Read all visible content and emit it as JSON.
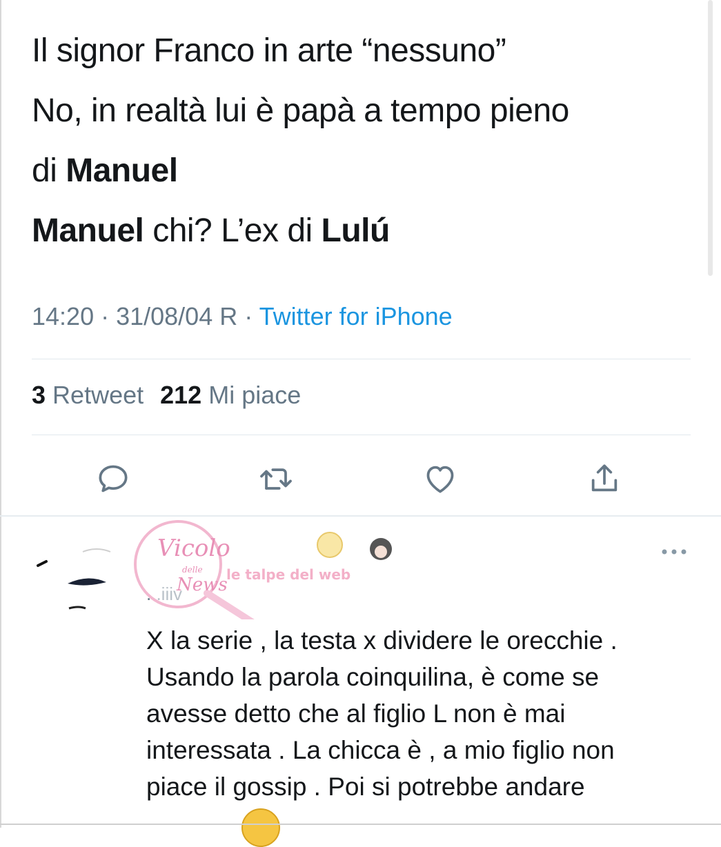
{
  "tweet": {
    "lines": [
      {
        "pre": "Il signor Franco in arte “nessuno”",
        "bold": "",
        "post": ""
      },
      {
        "pre": "No, in realtà lui è papà a tempo pieno",
        "bold": "",
        "post": ""
      },
      {
        "pre": "di ",
        "bold": "Manuel",
        "post": ""
      },
      {
        "bold": "Manuel",
        "mid": " chi? L’ex di ",
        "bold2": "Lulú"
      }
    ],
    "time": "14:20 · 31/08/04 R · ",
    "source": "Twitter for iPhone",
    "retweet_count": "3",
    "retweet_label": "Retweet",
    "like_count": "212",
    "like_label": "Mi piace"
  },
  "actions": {
    "icons": [
      "reply-icon",
      "retweet-icon",
      "like-icon",
      "share-icon"
    ]
  },
  "reply": {
    "handle_fragment": "...iiiv",
    "text_lines": [
      "X la serie , la testa x dividere le orecchie .",
      "Usando la parola coinquilina,  è come se",
      "avesse detto che al figlio L non è mai",
      "interessata . La chicca è , a mio figlio non",
      "piace il gossip . Poi si potrebbe andare"
    ]
  },
  "watermark": {
    "circle_text": "Vicolo",
    "circle_small": "delle",
    "circle_bottom": "News",
    "banner_text": "le talpe del web"
  },
  "colors": {
    "text": "#14171a",
    "muted": "#657786",
    "link": "#1b95e0",
    "divider": "#e1e8ed"
  }
}
